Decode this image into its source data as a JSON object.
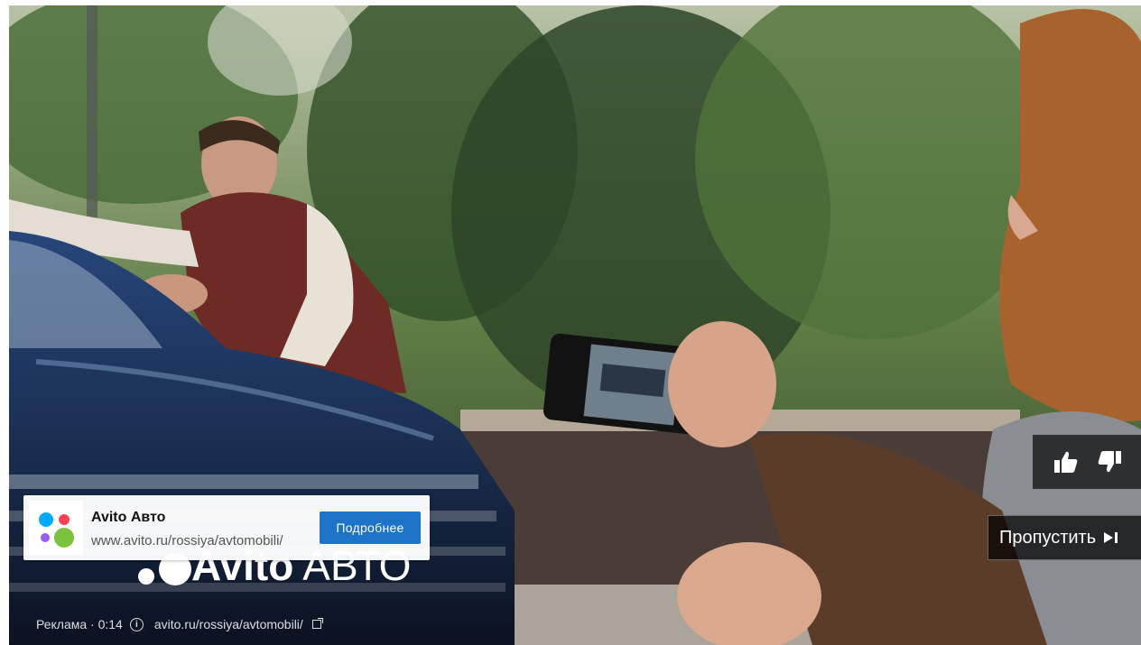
{
  "ad_card": {
    "title": "Avito Авто",
    "url": "www.avito.ru/rossiya/avtomobili/",
    "button_label": "Подробнее",
    "logo_dot_colors": [
      "#0af",
      "#ff4053",
      "#965eeb",
      "#7bc33d"
    ]
  },
  "brand_overlay": {
    "brand_bold": "Avito",
    "brand_light": "АВТО"
  },
  "ad_meta": {
    "label": "Реклама · 0:14",
    "link": "avito.ru/rossiya/avtomobili/"
  },
  "controls": {
    "like_icon": "thumb-up-icon",
    "dislike_icon": "thumb-down-icon",
    "skip_label": "Пропустить"
  }
}
